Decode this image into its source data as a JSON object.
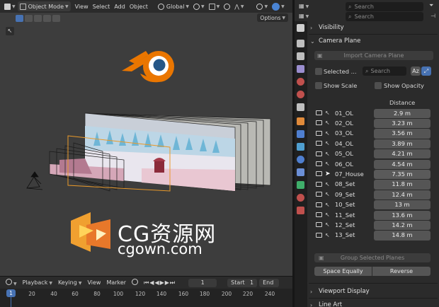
{
  "viewport": {
    "header": {
      "mode": "Object Mode",
      "menus": [
        "View",
        "Select",
        "Add",
        "Object"
      ],
      "transform_orientation": "Global"
    },
    "options_label": "Options"
  },
  "watermark": {
    "line1": "CG资源网",
    "line2": "cgown.com"
  },
  "timeline": {
    "menus": [
      "Playback",
      "Keying",
      "View",
      "Marker"
    ],
    "current_frame": "1",
    "start_label": "Start",
    "start_value": "1",
    "end_label": "End",
    "ticks": [
      "1",
      "20",
      "40",
      "60",
      "80",
      "100",
      "120",
      "140",
      "160",
      "180",
      "200",
      "220",
      "240"
    ]
  },
  "properties": {
    "search_placeholder": "Search",
    "sections": {
      "visibility": "Visibility",
      "camera_plane": "Camera Plane",
      "viewport_display": "Viewport Display",
      "line_art": "Line Art"
    },
    "camera_plane": {
      "import_button": "Import Camera Plane",
      "selected_label": "Selected ...",
      "list_search_placeholder": "Search",
      "sort_button": "Az",
      "show_scale": "Show Scale",
      "show_opacity": "Show Opacity",
      "distance_header": "Distance",
      "rows": [
        {
          "name": "01_OL",
          "distance": "2.9 m",
          "icon": "camera-icon"
        },
        {
          "name": "02_OL",
          "distance": "3.23 m",
          "icon": "camera-icon"
        },
        {
          "name": "03_OL",
          "distance": "3.56 m",
          "icon": "camera-icon"
        },
        {
          "name": "04_OL",
          "distance": "3.89 m",
          "icon": "camera-icon"
        },
        {
          "name": "05_OL",
          "distance": "4.21 m",
          "icon": "camera-icon"
        },
        {
          "name": "06_OL",
          "distance": "4.54 m",
          "icon": "camera-icon"
        },
        {
          "name": "07_House",
          "distance": "7.35 m",
          "icon": "cursor-icon"
        },
        {
          "name": "08_Set",
          "distance": "11.8 m",
          "icon": "camera-icon"
        },
        {
          "name": "09_Set",
          "distance": "12.4 m",
          "icon": "camera-icon"
        },
        {
          "name": "10_Set",
          "distance": "13 m",
          "icon": "camera-icon"
        },
        {
          "name": "11_Set",
          "distance": "13.6 m",
          "icon": "camera-icon"
        },
        {
          "name": "12_Set",
          "distance": "14.2 m",
          "icon": "camera-icon"
        },
        {
          "name": "13_Set",
          "distance": "14.8 m",
          "icon": "camera-icon"
        }
      ],
      "group_button": "Group Selected Planes",
      "space_equally_button": "Space Equally",
      "reverse_button": "Reverse"
    }
  },
  "colors": {
    "accent": "#4772b3",
    "blender_orange": "#ea7600",
    "blender_blue": "#265787"
  }
}
